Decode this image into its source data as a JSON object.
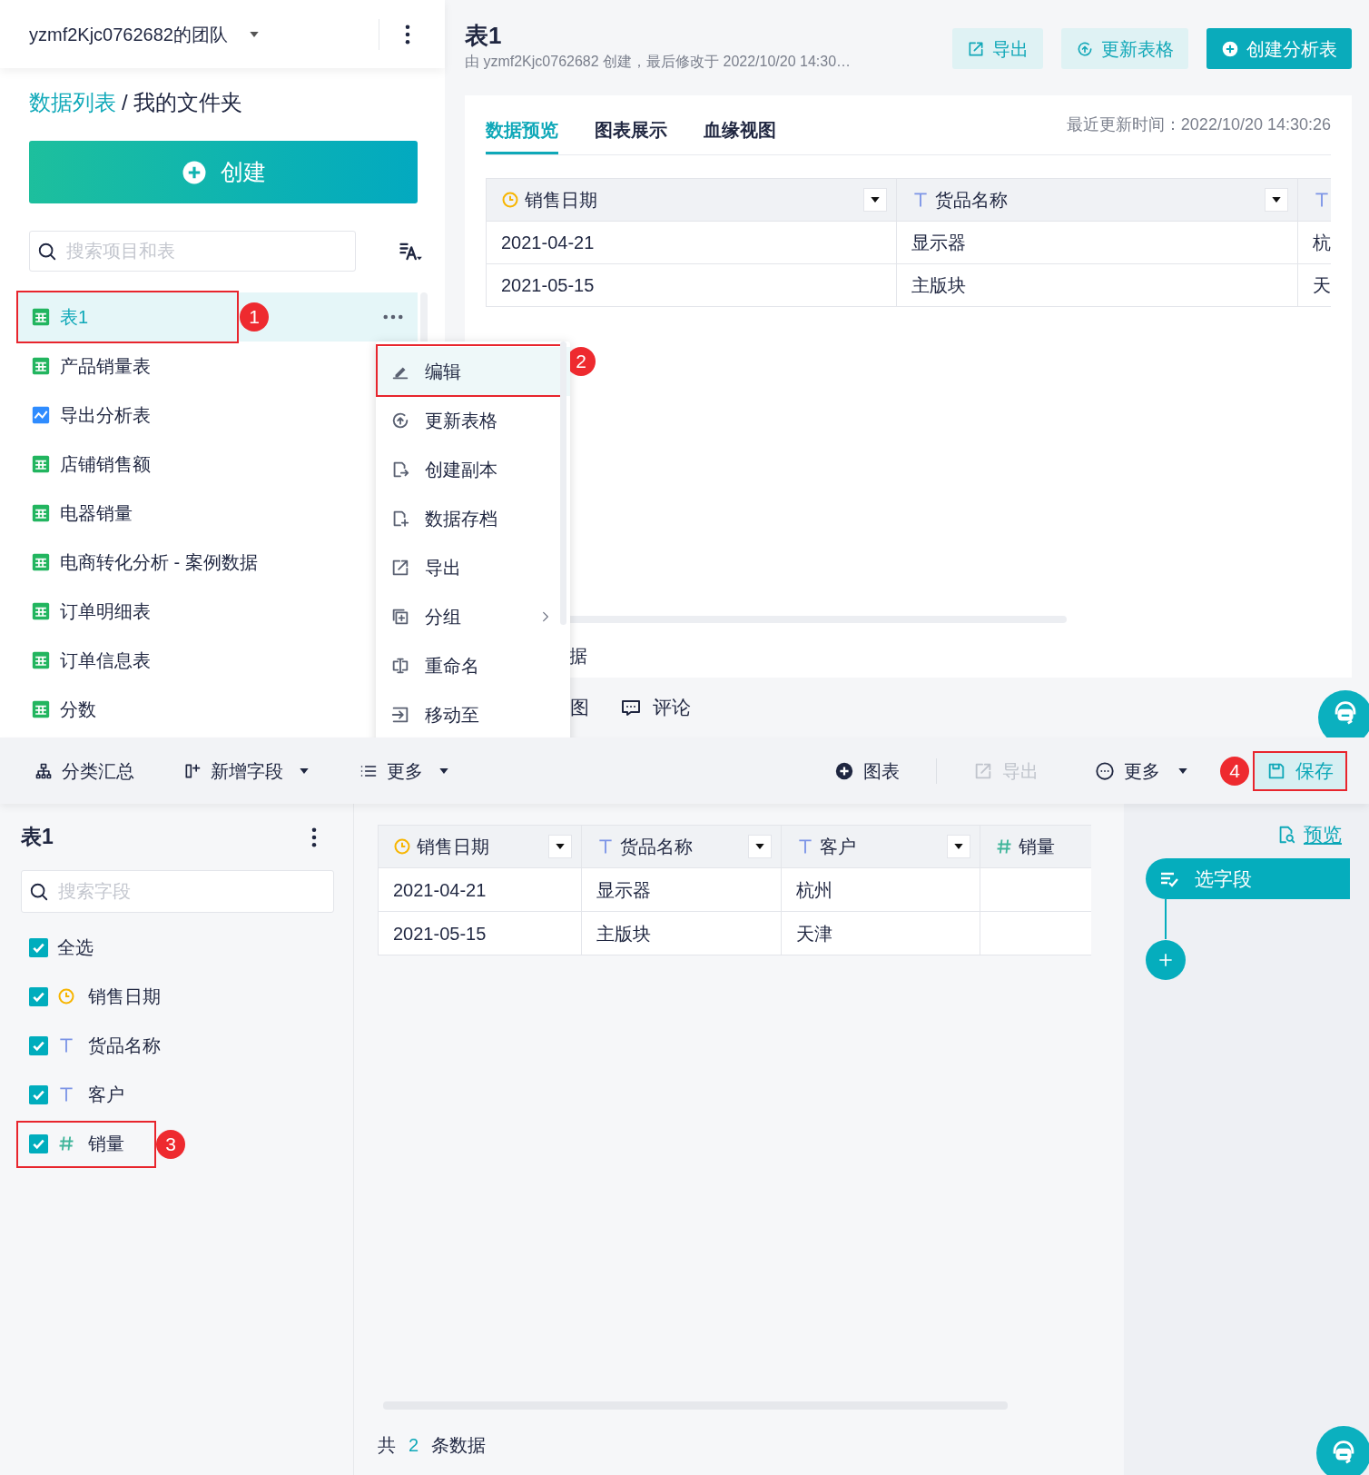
{
  "team": {
    "name": "yzmf2Kjc0762682的团队"
  },
  "breadcrumb": {
    "link": "数据列表",
    "separator": "/",
    "current": "我的文件夹"
  },
  "create_button": "创建",
  "sidebar_search": {
    "placeholder": "搜索项目和表"
  },
  "files": [
    {
      "name": "表1",
      "kind": "table",
      "selected": true,
      "callout": "1"
    },
    {
      "name": "产品销量表",
      "kind": "table",
      "selected": false
    },
    {
      "name": "导出分析表",
      "kind": "analysis",
      "selected": false
    },
    {
      "name": "店铺销售额",
      "kind": "table",
      "selected": false
    },
    {
      "name": "电器销量",
      "kind": "table",
      "selected": false
    },
    {
      "name": "电商转化分析 - 案例数据",
      "kind": "table",
      "selected": false
    },
    {
      "name": "订单明细表",
      "kind": "table",
      "selected": false
    },
    {
      "name": "订单信息表",
      "kind": "table",
      "selected": false
    },
    {
      "name": "分数",
      "kind": "table",
      "selected": false
    }
  ],
  "context_menu": [
    {
      "label": "编辑",
      "selected": true,
      "submenu": false,
      "callout": "2"
    },
    {
      "label": "更新表格",
      "selected": false,
      "submenu": false
    },
    {
      "label": "创建副本",
      "selected": false,
      "submenu": false
    },
    {
      "label": "数据存档",
      "selected": false,
      "submenu": false
    },
    {
      "label": "导出",
      "selected": false,
      "submenu": false
    },
    {
      "label": "分组",
      "selected": false,
      "submenu": true
    },
    {
      "label": "重命名",
      "selected": false,
      "submenu": false
    },
    {
      "label": "移动至",
      "selected": false,
      "submenu": false
    }
  ],
  "page": {
    "title": "表1",
    "subtitle": "由 yzmf2Kjc0762682 创建，最后修改于 2022/10/20 14:30…",
    "buttons": [
      {
        "label": "导出",
        "kind": "secondary"
      },
      {
        "label": "更新表格",
        "kind": "secondary"
      },
      {
        "label": "创建分析表",
        "kind": "primary"
      }
    ]
  },
  "preview": {
    "tabs": [
      {
        "label": "数据预览",
        "selected": true
      },
      {
        "label": "图表展示",
        "selected": false
      },
      {
        "label": "血缘视图",
        "selected": false
      }
    ],
    "updated": "最近更新时间：2022/10/20 14:30:26",
    "columns": [
      {
        "name": "销售日期",
        "kind": "date"
      },
      {
        "name": "货品名称",
        "kind": "text"
      },
      {
        "kind": "text"
      }
    ],
    "rows": [
      [
        "2021-04-21",
        "显示器",
        "杭"
      ],
      [
        "2021-05-15",
        "主版块",
        "天"
      ]
    ],
    "footer": "据",
    "lower_tabs": [
      "图",
      "评论"
    ]
  },
  "editor": {
    "toolbar_left": [
      {
        "label": "分类汇总",
        "caret": false
      },
      {
        "label": "新增字段",
        "caret": true
      },
      {
        "label": "更多",
        "caret": true
      }
    ],
    "toolbar_right": [
      {
        "label": "图表",
        "caret": false,
        "disabled": false
      },
      {
        "label": "导出",
        "caret": false,
        "disabled": true
      },
      {
        "label": "更多",
        "caret": true,
        "disabled": false
      }
    ],
    "save": {
      "label": "保存",
      "callout": "4"
    },
    "panel_title": "表1",
    "field_search": {
      "placeholder": "搜索字段"
    },
    "select_all": {
      "label": "全选",
      "checked": true
    },
    "fields": [
      {
        "name": "销售日期",
        "kind": "date",
        "checked": true
      },
      {
        "name": "货品名称",
        "kind": "text",
        "checked": true
      },
      {
        "name": "客户",
        "kind": "text",
        "checked": true
      },
      {
        "name": "销量",
        "kind": "number",
        "checked": true,
        "callout": "3"
      }
    ],
    "table": {
      "columns": [
        {
          "name": "销售日期",
          "kind": "date",
          "filter": true
        },
        {
          "name": "货品名称",
          "kind": "text",
          "filter": true
        },
        {
          "name": "客户",
          "kind": "text",
          "filter": true
        },
        {
          "name": "销量",
          "kind": "number",
          "filter": false
        }
      ],
      "rows": [
        [
          "2021-04-21",
          "显示器",
          "杭州"
        ],
        [
          "2021-05-15",
          "主版块",
          "天津"
        ]
      ]
    },
    "footer": {
      "prefix": "共",
      "count": "2",
      "suffix": "条数据"
    },
    "flow": {
      "preview_link": "预览",
      "step": "选字段"
    }
  }
}
